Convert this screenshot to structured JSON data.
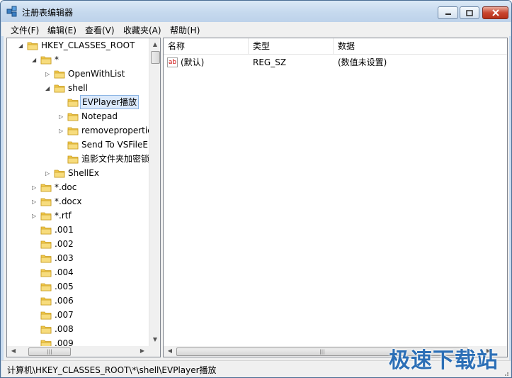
{
  "window": {
    "title": "注册表编辑器",
    "buttons": {
      "minimize": "minimize",
      "maximize": "maximize",
      "close": "close"
    }
  },
  "menu": [
    "文件(F)",
    "编辑(E)",
    "查看(V)",
    "收藏夹(A)",
    "帮助(H)"
  ],
  "tree": {
    "items": [
      {
        "label": "HKEY_CLASSES_ROOT",
        "level": 0,
        "expander": "expanded",
        "selected": false
      },
      {
        "label": "*",
        "level": 1,
        "expander": "expanded",
        "selected": false
      },
      {
        "label": "OpenWithList",
        "level": 2,
        "expander": "collapsed",
        "selected": false
      },
      {
        "label": "shell",
        "level": 2,
        "expander": "expanded",
        "selected": false
      },
      {
        "label": "EVPlayer播放",
        "level": 3,
        "expander": "none",
        "selected": true
      },
      {
        "label": "Notepad",
        "level": 3,
        "expander": "collapsed",
        "selected": false
      },
      {
        "label": "removepropertie",
        "level": 3,
        "expander": "collapsed",
        "selected": false
      },
      {
        "label": "Send To VSFileEn",
        "level": 3,
        "expander": "none",
        "selected": false
      },
      {
        "label": "追影文件夹加密锁",
        "level": 3,
        "expander": "none",
        "selected": false
      },
      {
        "label": "ShellEx",
        "level": 2,
        "expander": "collapsed",
        "selected": false
      },
      {
        "label": "*.doc",
        "level": 1,
        "expander": "collapsed",
        "selected": false
      },
      {
        "label": "*.docx",
        "level": 1,
        "expander": "collapsed",
        "selected": false
      },
      {
        "label": "*.rtf",
        "level": 1,
        "expander": "collapsed",
        "selected": false
      },
      {
        "label": ".001",
        "level": 1,
        "expander": "none",
        "selected": false
      },
      {
        "label": ".002",
        "level": 1,
        "expander": "none",
        "selected": false
      },
      {
        "label": ".003",
        "level": 1,
        "expander": "none",
        "selected": false
      },
      {
        "label": ".004",
        "level": 1,
        "expander": "none",
        "selected": false
      },
      {
        "label": ".005",
        "level": 1,
        "expander": "none",
        "selected": false
      },
      {
        "label": ".006",
        "level": 1,
        "expander": "none",
        "selected": false
      },
      {
        "label": ".007",
        "level": 1,
        "expander": "none",
        "selected": false
      },
      {
        "label": ".008",
        "level": 1,
        "expander": "none",
        "selected": false
      },
      {
        "label": ".009",
        "level": 1,
        "expander": "none",
        "selected": false
      }
    ]
  },
  "list": {
    "columns": [
      "名称",
      "类型",
      "数据"
    ],
    "rows": [
      {
        "icon": "ab",
        "name": "(默认)",
        "type": "REG_SZ",
        "data": "(数值未设置)"
      }
    ]
  },
  "status": {
    "path": "计算机\\HKEY_CLASSES_ROOT\\*\\shell\\EVPlayer播放"
  },
  "watermark": "极速下载站",
  "colors": {
    "selection": "#dbe9fb",
    "folder": "#f2c94c",
    "watermark": "#2c6fb6"
  }
}
